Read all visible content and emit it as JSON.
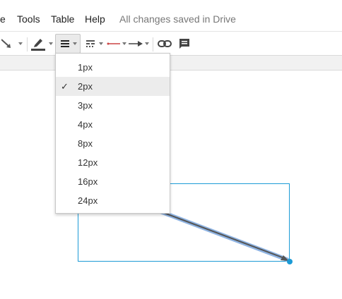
{
  "menu": {
    "items": [
      "e",
      "Tools",
      "Table",
      "Help"
    ],
    "status": "All changes saved in Drive"
  },
  "toolbar": {
    "icons": [
      "line-arrow-icon",
      "pen-color-icon",
      "line-weight-icon",
      "line-dash-icon",
      "line-start-icon",
      "line-end-icon",
      "link-icon",
      "comment-icon"
    ],
    "active": "line-weight-icon"
  },
  "line_weight_menu": {
    "options": [
      {
        "label": "1px",
        "selected": false
      },
      {
        "label": "2px",
        "selected": true
      },
      {
        "label": "3px",
        "selected": false
      },
      {
        "label": "4px",
        "selected": false
      },
      {
        "label": "8px",
        "selected": false
      },
      {
        "label": "12px",
        "selected": false
      },
      {
        "label": "16px",
        "selected": false
      },
      {
        "label": "24px",
        "selected": false
      }
    ],
    "check_glyph": "✓"
  },
  "colors": {
    "selection": "#1c9bd6",
    "arrow": "#555555",
    "arrow_highlight": "#8fb4e3"
  }
}
